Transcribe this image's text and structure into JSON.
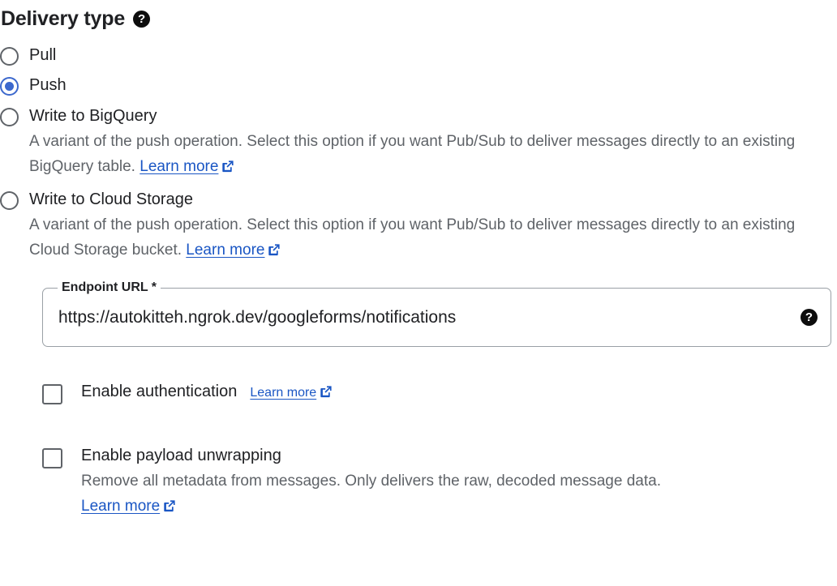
{
  "section": {
    "title": "Delivery type",
    "help_icon": "help-icon",
    "help_label": "?"
  },
  "colors": {
    "accent_blue": "#3c68cd",
    "link_blue": "#1a56c4",
    "text_primary": "#202124",
    "text_secondary": "#5f6368",
    "border_gray": "#9aa0a6",
    "help_icon_bg": "#0d0d0d"
  },
  "delivery_options": [
    {
      "id": "pull",
      "label": "Pull",
      "selected": false,
      "description": "",
      "link": "",
      "link_icon": ""
    },
    {
      "id": "push",
      "label": "Push",
      "selected": true,
      "description": "",
      "link": "",
      "link_icon": ""
    },
    {
      "id": "write-to-bigquery",
      "label": "Write to BigQuery",
      "selected": false,
      "description": "A variant of the push operation. Select this option if you want Pub/Sub to deliver messages directly to an existing BigQuery table.",
      "link": "Learn more",
      "link_icon": "external-link-icon"
    },
    {
      "id": "write-to-cloud-storage",
      "label": "Write to Cloud Storage",
      "selected": false,
      "description": "A variant of the push operation. Select this option if you want Pub/Sub to deliver messages directly to an existing Cloud Storage bucket.",
      "link": "Learn more",
      "link_icon": "external-link-icon"
    }
  ],
  "endpoint_field": {
    "label": "Endpoint URL *",
    "value": "https://autokitteh.ngrok.dev/googleforms/notifications",
    "placeholder": "https://",
    "help_label": "?",
    "help_icon": "help-icon"
  },
  "checkboxes": [
    {
      "id": "enable-authentication",
      "label": "Enable authentication",
      "checked": false,
      "link": "Learn more",
      "link_icon": "external-link-icon",
      "description": ""
    },
    {
      "id": "enable-payload-unwrapping",
      "label": "Enable payload unwrapping",
      "checked": false,
      "description": "Remove all metadata from messages. Only delivers the raw, decoded message data.",
      "link": "Learn more",
      "link_icon": "external-link-icon"
    }
  ]
}
